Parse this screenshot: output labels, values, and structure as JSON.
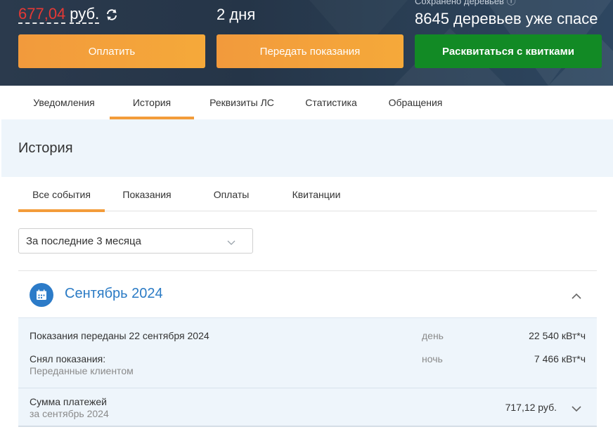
{
  "banner": {
    "balance_amount": "677,04",
    "balance_currency": "руб.",
    "days_value": "2 дня",
    "trees_label": "Сохранено деревьев ⓘ",
    "trees_value": "8645 деревьев уже спасе",
    "buttons": {
      "pay": "Оплатить",
      "send_readings": "Передать показания",
      "paper_free": "Расквитаться с квитками"
    }
  },
  "main_tabs": [
    {
      "label": "Уведомления"
    },
    {
      "label": "История"
    },
    {
      "label": "Реквизиты ЛС"
    },
    {
      "label": "Статистика"
    },
    {
      "label": "Обращения"
    }
  ],
  "history": {
    "title": "История",
    "sub_tabs": [
      {
        "label": "Все события"
      },
      {
        "label": "Показания"
      },
      {
        "label": "Оплаты"
      },
      {
        "label": "Квитанции"
      }
    ],
    "period_value": "За последние 3 месяца",
    "month": {
      "title": "Сентябрь 2024",
      "readings": {
        "title": "Показания переданы 22 сентября 2024",
        "taken_by": "Снял показания:",
        "taken_by_value": "Переданные клиентом",
        "day_label": "день",
        "day_value": "22 540 кВт*ч",
        "night_label": "ночь",
        "night_value": "7 466 кВт*ч"
      },
      "payments": {
        "title": "Сумма платежей",
        "subtitle": "за сентябрь 2024",
        "amount": "717,12 руб."
      }
    }
  },
  "colors": {
    "accent_orange": "#f39c3a",
    "accent_green": "#128a25",
    "accent_blue": "#2b7bc5",
    "debt_red": "#e53935",
    "banner_bg": "#253548",
    "panel_bg": "#eef5fb"
  }
}
